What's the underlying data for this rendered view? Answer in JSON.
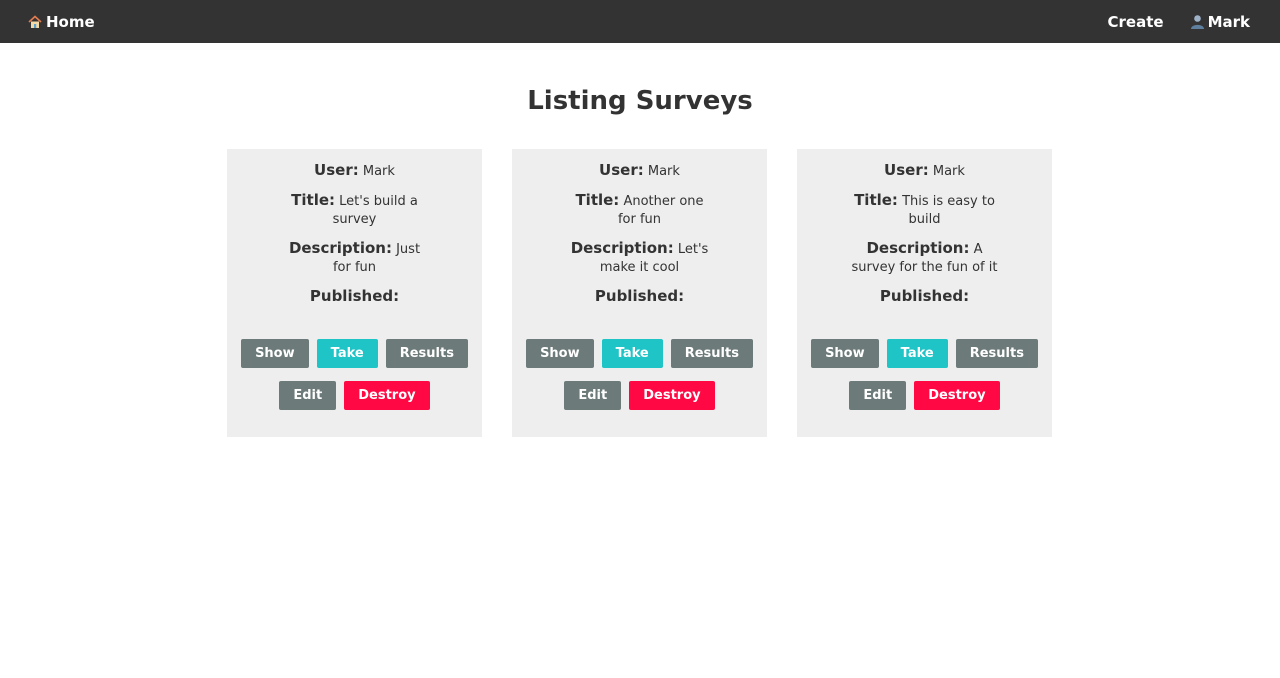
{
  "nav": {
    "home_label": "Home",
    "create_label": "Create",
    "user_label": "Mark"
  },
  "page": {
    "title": "Listing Surveys"
  },
  "labels": {
    "user": "User:",
    "title": "Title:",
    "description": "Description:",
    "published": "Published:"
  },
  "buttons": {
    "show": "Show",
    "take": "Take",
    "results": "Results",
    "edit": "Edit",
    "destroy": "Destroy"
  },
  "surveys": [
    {
      "user": "Mark",
      "title": "Let's build a survey",
      "description": "Just for fun",
      "published": ""
    },
    {
      "user": "Mark",
      "title": "Another one for fun",
      "description": "Let's make it cool",
      "published": ""
    },
    {
      "user": "Mark",
      "title": "This is easy to build",
      "description": "A survey for the fun of it",
      "published": ""
    }
  ],
  "colors": {
    "navbar": "#333333",
    "card_bg": "#eeeeee",
    "button_gray": "#6c7a7a",
    "button_teal": "#1ec4c6",
    "button_red": "#ff0844"
  },
  "icons": {
    "home": "home-icon",
    "user": "user-icon"
  }
}
